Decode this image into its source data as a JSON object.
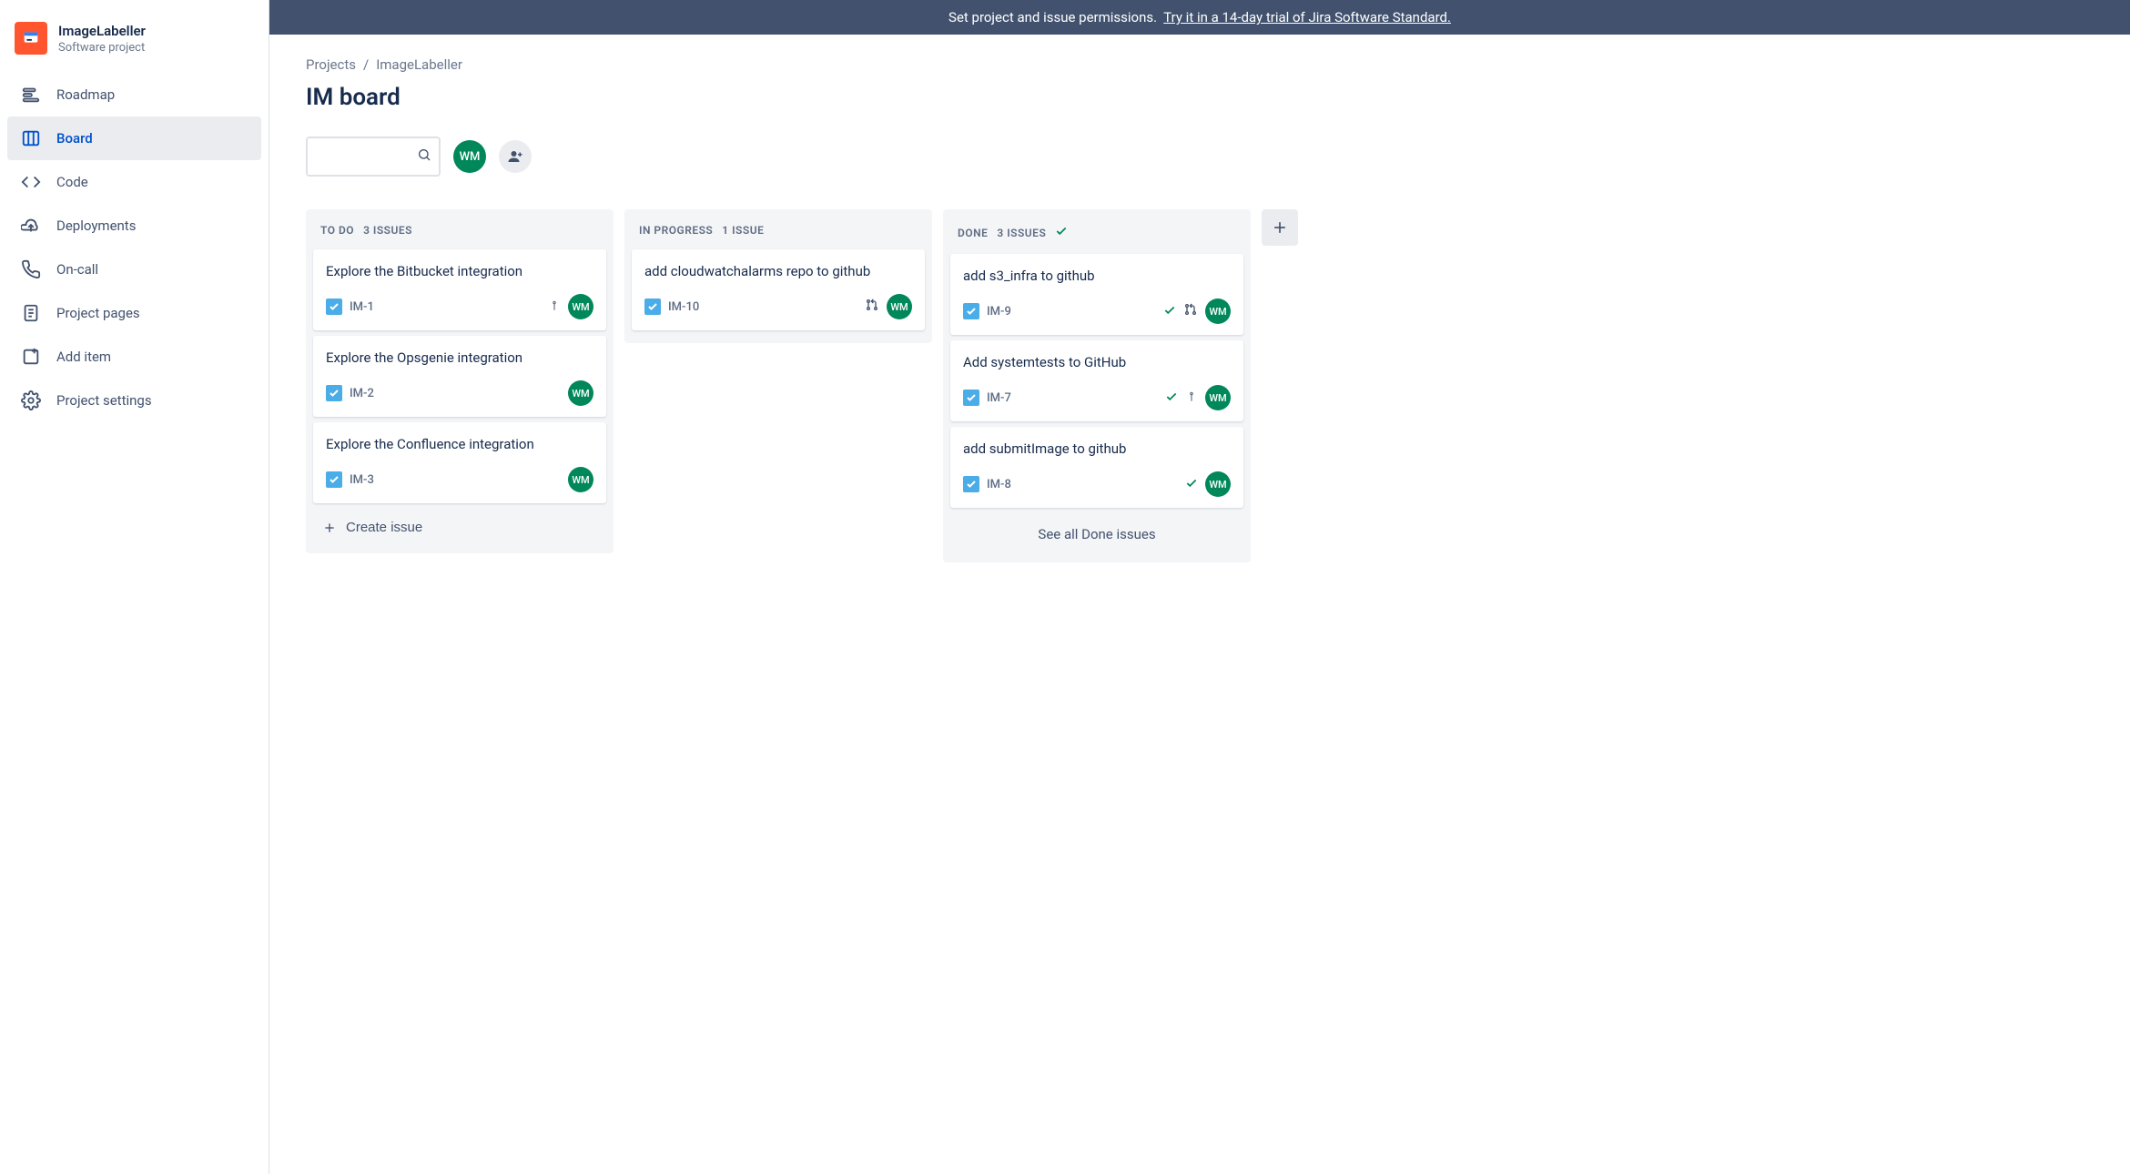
{
  "banner": {
    "text": "Set project and issue permissions.",
    "link_text": "Try it in a 14-day trial of Jira Software Standard."
  },
  "project": {
    "name": "ImageLabeller",
    "type": "Software project"
  },
  "sidebar": {
    "items": [
      {
        "label": "Roadmap",
        "icon": "roadmap-icon",
        "active": false
      },
      {
        "label": "Board",
        "icon": "board-icon",
        "active": true
      },
      {
        "label": "Code",
        "icon": "code-icon",
        "active": false
      },
      {
        "label": "Deployments",
        "icon": "deployments-icon",
        "active": false
      },
      {
        "label": "On-call",
        "icon": "oncall-icon",
        "active": false
      },
      {
        "label": "Project pages",
        "icon": "pages-icon",
        "active": false
      },
      {
        "label": "Add item",
        "icon": "add-item-icon",
        "active": false
      },
      {
        "label": "Project settings",
        "icon": "settings-icon",
        "active": false
      }
    ]
  },
  "breadcrumb": {
    "root": "Projects",
    "separator": "/",
    "current": "ImageLabeller"
  },
  "page_title": "IM board",
  "user_initials": "WM",
  "columns": [
    {
      "name": "TO DO",
      "count_label": "3 ISSUES",
      "done": false,
      "cards": [
        {
          "title": "Explore the Bitbucket integration",
          "key": "IM-1",
          "assignee": "WM",
          "priority": true
        },
        {
          "title": "Explore the Opsgenie integration",
          "key": "IM-2",
          "assignee": "WM"
        },
        {
          "title": "Explore the Confluence integration",
          "key": "IM-3",
          "assignee": "WM"
        }
      ],
      "create": "Create issue"
    },
    {
      "name": "IN PROGRESS",
      "count_label": "1 ISSUE",
      "done": false,
      "cards": [
        {
          "title": "add cloudwatchalarms repo to github",
          "key": "IM-10",
          "assignee": "WM",
          "pr": true
        }
      ]
    },
    {
      "name": "DONE",
      "count_label": "3 ISSUES",
      "done": true,
      "cards": [
        {
          "title": "add s3_infra to github",
          "key": "IM-9",
          "assignee": "WM",
          "done_check": true,
          "pr": true
        },
        {
          "title": "Add systemtests to GitHub",
          "key": "IM-7",
          "assignee": "WM",
          "done_check": true,
          "priority": true
        },
        {
          "title": "add submitImage to github",
          "key": "IM-8",
          "assignee": "WM",
          "done_check": true
        }
      ],
      "see_all": "See all Done issues"
    }
  ]
}
